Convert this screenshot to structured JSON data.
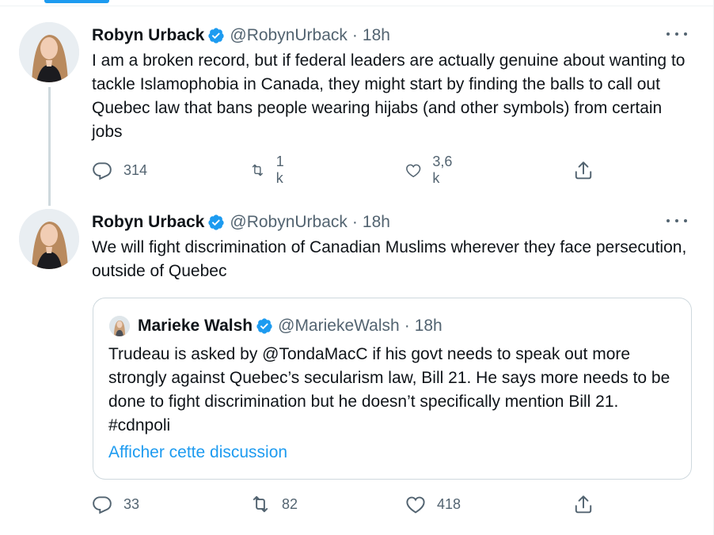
{
  "tweets": [
    {
      "author": {
        "name": "Robyn Urback",
        "handle": "@RobynUrback",
        "time": "18h",
        "verified": true
      },
      "text": "I am a broken record, but if federal leaders are actually genuine about wanting to tackle Islamophobia in Canada, they might start by finding the balls to call out Quebec law that bans people wearing hijabs (and other symbols) from certain jobs",
      "stats": {
        "replies": "314",
        "retweets": "1 k",
        "likes": "3,6 k"
      }
    },
    {
      "author": {
        "name": "Robyn Urback",
        "handle": "@RobynUrback",
        "time": "18h",
        "verified": true
      },
      "text": "We will fight discrimination of Canadian Muslims wherever they face persecution, outside of Quebec",
      "quote": {
        "author": {
          "name": "Marieke Walsh",
          "handle": "@MariekeWalsh",
          "time": "18h",
          "verified": true
        },
        "text": "Trudeau is asked by @TondaMacC if his govt needs to speak out more strongly against Quebec’s secularism law, Bill 21. He says more needs to be done to fight discrimination but he doesn’t specifically mention Bill 21. #cdnpoli",
        "link": "Afficher cette discussion"
      },
      "stats": {
        "replies": "33",
        "retweets": "82",
        "likes": "418"
      }
    }
  ],
  "separator": "·",
  "icons": {
    "verified": "verified-badge-icon",
    "more": "more-options-icon",
    "reply": "reply-icon",
    "retweet": "retweet-icon",
    "like": "like-icon",
    "share": "share-icon"
  },
  "colors": {
    "accent": "#1d9bf0",
    "text": "#0f1419",
    "secondary": "#536471",
    "border": "#cfd9de"
  }
}
